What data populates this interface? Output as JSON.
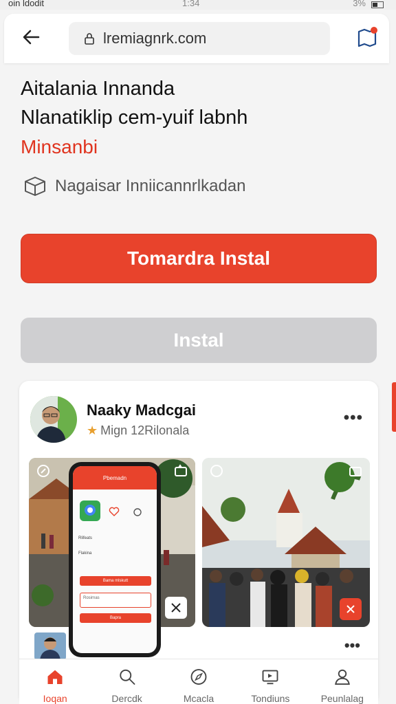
{
  "status": {
    "carrier": "oin ldodit",
    "time": "1:34",
    "battery": "3%"
  },
  "browser": {
    "url": "lremiagnrk.com"
  },
  "app": {
    "title_line1": "Aitalania Innanda",
    "title_line2": "Nlanatiklip cem-yuif labnh",
    "developer": "Minsanbi",
    "note": "Nagaisar Inniicannrlkadan"
  },
  "buttons": {
    "primary": "Tomardra Instal",
    "secondary": "Instal"
  },
  "post": {
    "name": "Naaky Madcgai",
    "meta": "Mign 12Rilonala",
    "more": "•••"
  },
  "phone_mock": {
    "header": "Pbemadn",
    "btn1": "Bama mlskutt",
    "btn2": "Bapra",
    "input": "Rosirnas",
    "row1": "Rlifeats",
    "row2": "Flakina"
  },
  "nav": [
    {
      "label": "Ioqan",
      "icon": "home-icon"
    },
    {
      "label": "Dercdk",
      "icon": "search-icon"
    },
    {
      "label": "Mcacla",
      "icon": "compass-icon"
    },
    {
      "label": "Tondiuns",
      "icon": "tv-icon"
    },
    {
      "label": "Peunlalag",
      "icon": "profile-icon"
    }
  ],
  "colors": {
    "accent": "#e8432c",
    "secondary_button": "#cfcfd1"
  }
}
